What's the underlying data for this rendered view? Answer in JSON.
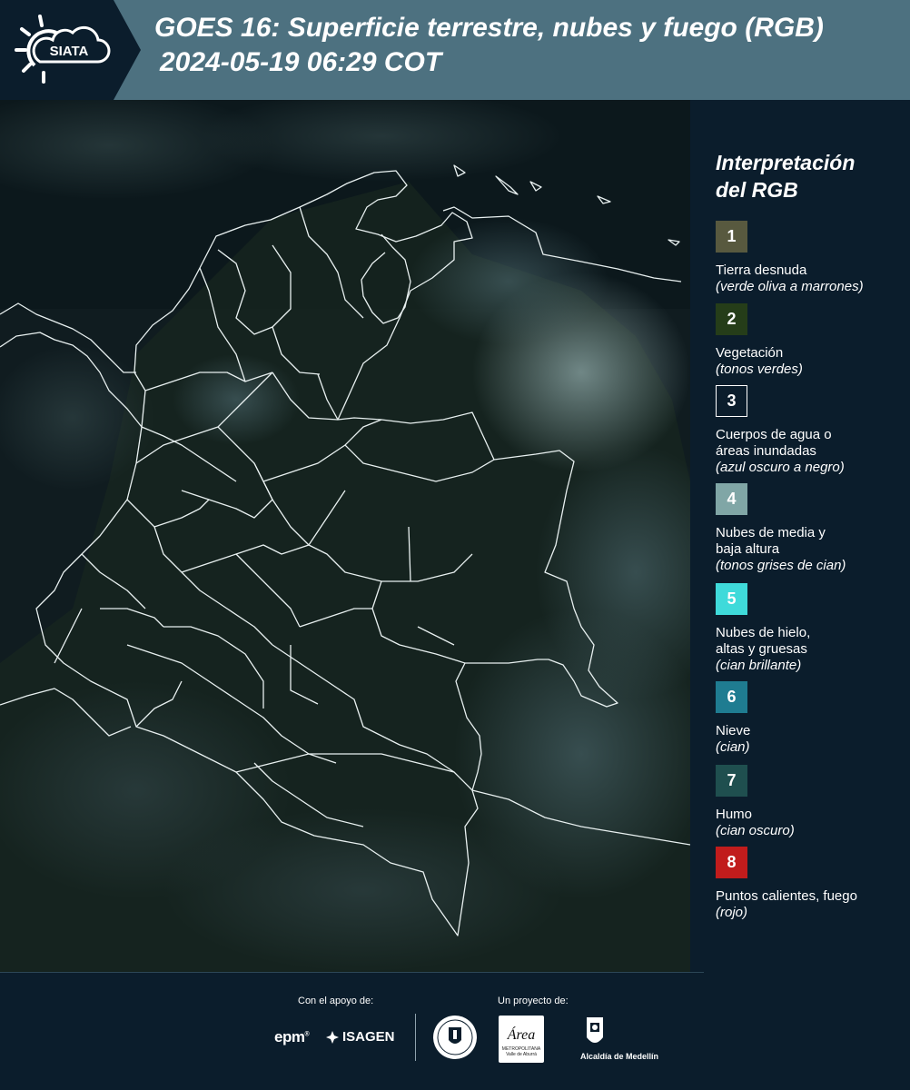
{
  "header": {
    "logo_text": "SIATA",
    "title_line1": "GOES 16: Superficie terrestre, nubes y fuego (RGB)",
    "title_line2": "2024-05-19 06:29 COT"
  },
  "legend": {
    "title_line1": "Interpretación",
    "title_line2": "del RGB",
    "items": [
      {
        "number": "1",
        "color": "#58593f",
        "outlined": false,
        "name": "Tierra desnuda",
        "desc": "(verde oliva a marrones)"
      },
      {
        "number": "2",
        "color": "#253d19",
        "outlined": false,
        "name": "Vegetación",
        "desc": "(tonos verdes)"
      },
      {
        "number": "3",
        "color": "#0b1d2c",
        "outlined": true,
        "name": "Cuerpos de agua o áreas inundadas",
        "desc": "(azul oscuro a negro)"
      },
      {
        "number": "4",
        "color": "#80a6a6",
        "outlined": false,
        "name": "Nubes de media y baja altura",
        "desc": "(tonos grises de cian)"
      },
      {
        "number": "5",
        "color": "#3fdada",
        "outlined": false,
        "name": "Nubes de hielo, altas y gruesas",
        "desc": "(cian brillante)"
      },
      {
        "number": "6",
        "color": "#1f7c91",
        "outlined": false,
        "name": "Nieve",
        "desc": "(cian)"
      },
      {
        "number": "7",
        "color": "#1f4f4f",
        "outlined": false,
        "name": "Humo",
        "desc": "(cian oscuro)"
      },
      {
        "number": "8",
        "color": "#c11c1c",
        "outlined": false,
        "name": "Puntos calientes, fuego",
        "desc": "(rojo)"
      }
    ]
  },
  "footer": {
    "support_label": "Con el apoyo de:",
    "project_label": "Un proyecto de:",
    "sponsor1": "epm",
    "sponsor2": "ISAGEN",
    "area_logo_name": "Área",
    "area_logo_subtitle": "METROPOLITANA",
    "area_logo_tagline": "Valle de Aburrá",
    "medellin_label": "Alcaldía de Medellín"
  },
  "colors": {
    "header_bg": "#4d7180",
    "logo_bg": "#0b1d2c",
    "panel_bg": "#0b1d2c",
    "border_line": "#ffffff"
  }
}
